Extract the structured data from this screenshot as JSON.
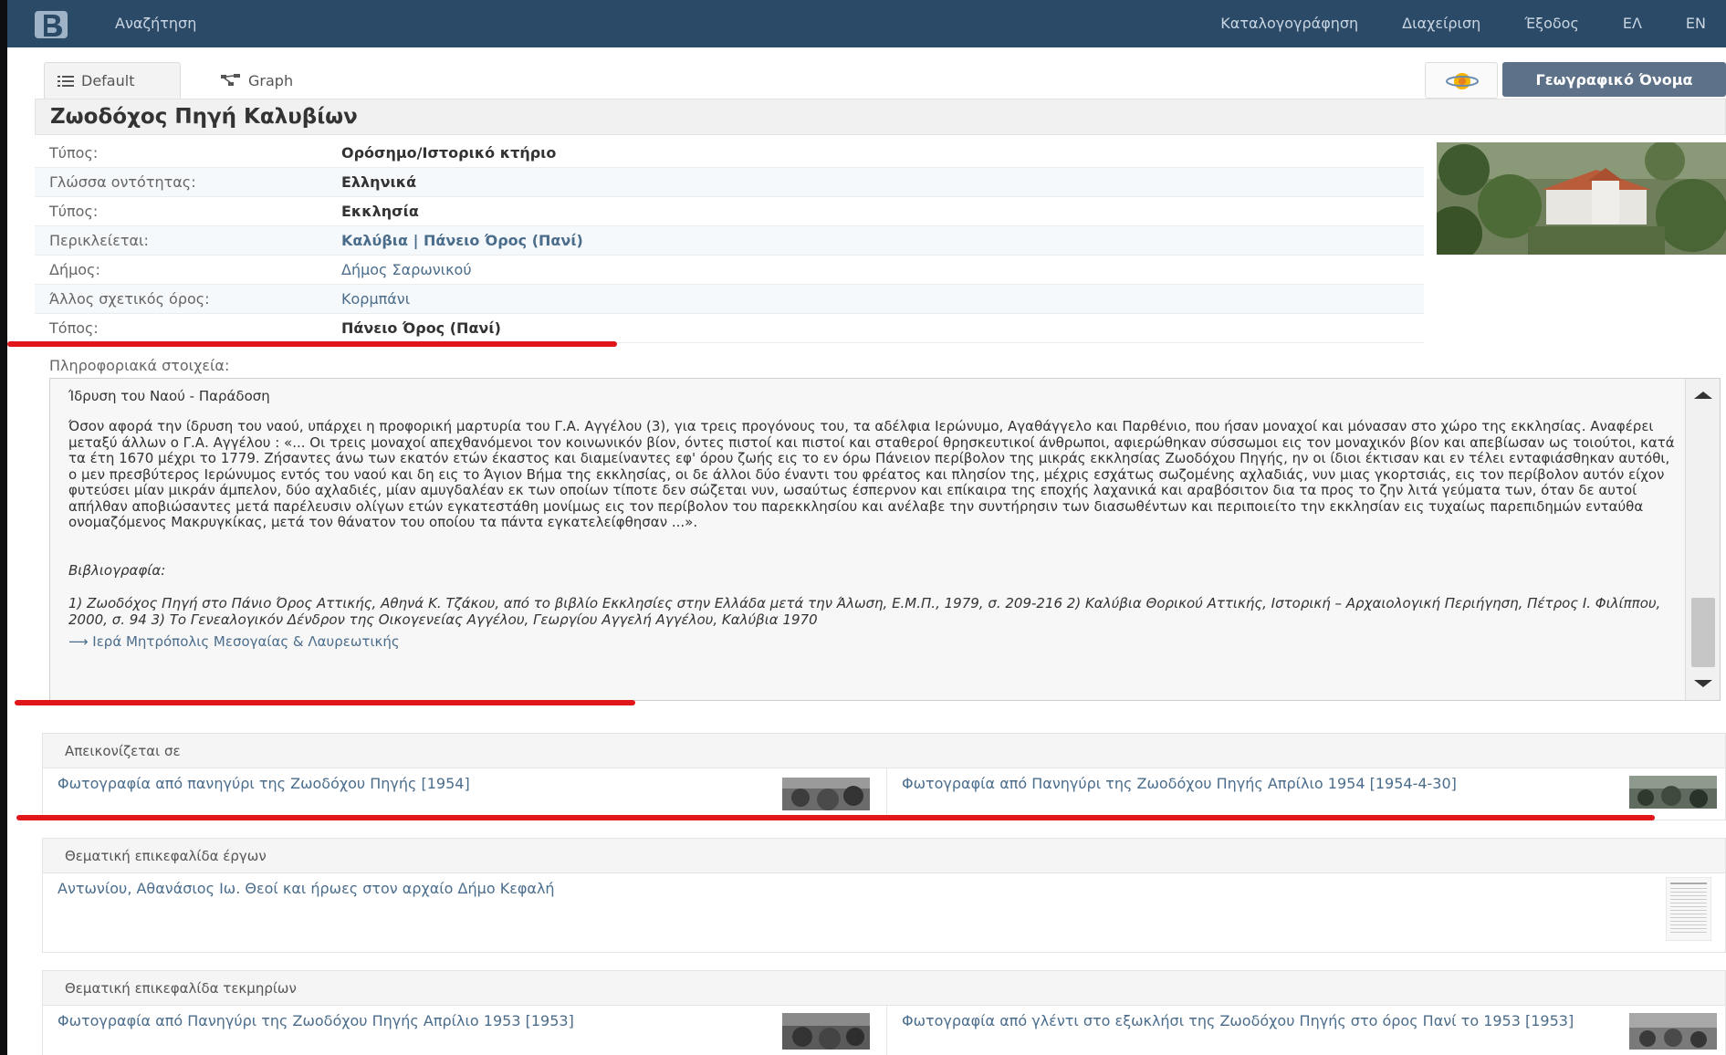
{
  "nav": {
    "search": "Αναζήτηση",
    "items": [
      "Καταλογογράφηση",
      "Διαχείριση",
      "Έξοδος",
      "ΕΛ",
      "EN"
    ]
  },
  "tabs": {
    "default": "Default",
    "graph": "Graph"
  },
  "primary_button": "Γεωγραφικό Όνομα",
  "title": "Ζωοδόχος Πηγή Καλυβίων",
  "properties": [
    {
      "label": "Τύπος:",
      "value": "Ορόσημο/Ιστορικό κτήριο"
    },
    {
      "label": "Γλώσσα οντότητας:",
      "value": "Ελληνικά"
    },
    {
      "label": "Τύπος:",
      "value": "Εκκλησία"
    },
    {
      "label": "Περικλείεται:",
      "value": "Καλύβια | Πάνειο Όρος (Πανί)"
    },
    {
      "label": "Δήμος:",
      "value": "Δήμος Σαρωνικού"
    },
    {
      "label": "Άλλος σχετικός όρος:",
      "value": "Κορμπάνι"
    },
    {
      "label": "Τόπος:",
      "value": "Πάνειο Όρος (Πανί)"
    }
  ],
  "info": {
    "label": "Πληροφοριακά στοιχεία:",
    "heading": "Ίδρυση του Ναού - Παράδοση",
    "body": "Όσον αφορά την ίδρυση του ναού, υπάρχει η προφορική μαρτυρία του Γ.Α. Αγγέλου (3), για τρεις προγόνους του, τα αδέλφια Ιερώνυμο, Αγαθάγγελο και Παρθένιο, που ήσαν μοναχοί και μόνασαν στο χώρο της εκκλησίας. Αναφέρει μεταξύ άλλων ο Γ.Α. Αγγέλου : «... Οι τρεις μοναχοί απεχθανόμενοι τον κοινωνικόν βίον, όντες πιστοί και πιστοί και σταθεροί θρησκευτικοί άνθρωποι, αφιερώθηκαν σύσσωμοι εις τον μοναχικόν βίον και απεβίωσαν ως τοιούτοι, κατά τα έτη 1670 μέχρι το 1779. Ζήσαντες άνω των εκατόν ετών έκαστος και διαμείναντες εφ' όρου ζωής εις το εν όρω Πάνειον περίβολον της μικράς εκκλησίας Ζωοδόχου Πηγής, ην οι ίδιοι έκτισαν και εν τέλει ενταφιάσθηκαν αυτόθι, ο μεν πρεσβύτερος Ιερώνυμος εντός του ναού και δη εις το Άγιον Βήμα της εκκλησίας, οι δε άλλοι δύο έναντι του φρέατος και πλησίον της, μέχρις εσχάτως σωζομένης αχλαδιάς, νυν μιας γκορτσιάς, εις τον περίβολον αυτόν είχον φυτεύσει μίαν μικράν άμπελον, δύο αχλαδιές, μίαν αμυγδαλέαν εκ των οποίων τίποτε δεν σώζεται νυν, ωσαύτως έσπερνον και επίκαιρα της εποχής λαχανικά και αραβόσιτον δια τα προς το ζην λιτά γεύματα των, όταν δε αυτοί απήλθαν αποβιώσαντες μετά παρέλευσιν ολίγων ετών εγκατεστάθη μονίμως εις τον περίβολον του παρεκκλησίου και ανέλαβε την συντήρησιν των διασωθέντων και περιποιείτο την εκκλησίαν εις τυχαίως παρεπιδημών ενταύθα ονομαζόμενος Μακρυγκίκας, μετά τον θάνατον του οποίου τα πάντα εγκατελείφθησαν ...».",
    "bib_title": "Βιβλιογραφία:",
    "bib_text": "1) Ζωοδόχος Πηγή στο Πάνιο Όρος Αττικής, Αθηνά Κ. Τζάκου, από το βιβλίο Εκκλησίες στην Ελλάδα μετά την Άλωση, Ε.Μ.Π., 1979, σ. 209-216 2) Καλύβια Θορικού Αττικής, Ιστορική – Αρχαιολογική Περιήγηση, Πέτρος Ι. Φιλίππου, 2000, σ. 94 3) Το Γενεαλογικόν Δένδρον της Οικογενείας Αγγέλου, Γεωργίου Αγγελή Αγγέλου, Καλύβια 1970",
    "link": "⟶ Ιερά Μητρόπολις Μεσογαίας & Λαυρεωτικής"
  },
  "depicted_in": {
    "header": "Απεικονίζεται σε",
    "items": [
      "Φωτογραφία από πανηγύρι της Ζωοδόχου Πηγής [1954]",
      "Φωτογραφία από Πανηγύρι της Ζωοδόχου Πηγής Απρίλιο 1954 [1954-4-30]"
    ]
  },
  "works_subject": {
    "header": "Θεματική επικεφαλίδα έργων",
    "items": [
      "Αντωνίου, Αθανάσιος Ιω. Θεοί και ήρωες στον αρχαίο Δήμο Κεφαλή"
    ]
  },
  "evidence_subject": {
    "header": "Θεματική επικεφαλίδα τεκμηρίων",
    "items": [
      "Φωτογραφία από Πανηγύρι της Ζωοδόχου Πηγής Απρίλιο 1953 [1953]",
      "Φωτογραφία από γλέντι στο εξωκλήσι της Ζωοδόχου Πηγής στο όρος Πανί το 1953 [1953]"
    ]
  },
  "colors": {
    "navbar": "#2b4a68",
    "primary_button": "#5d7289",
    "link": "#4b6d8c",
    "highlight_line": "#e0161b"
  }
}
